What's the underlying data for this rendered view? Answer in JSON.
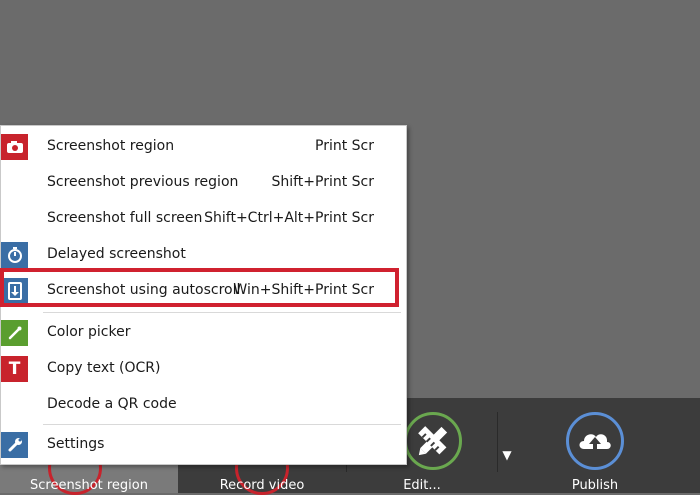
{
  "toolbar": {
    "buttons": [
      {
        "label": "Screenshot region"
      },
      {
        "label": "Record video"
      },
      {
        "label": "Edit..."
      },
      {
        "label": "Publish"
      }
    ],
    "dropdown_glyph": "▼"
  },
  "menu": {
    "items": [
      {
        "label": "Screenshot region",
        "shortcut": "Print Scr",
        "icon": "camera-icon"
      },
      {
        "label": "Screenshot previous region",
        "shortcut": "Shift+Print Scr"
      },
      {
        "label": "Screenshot full screen",
        "shortcut": "Shift+Ctrl+Alt+Print Scr"
      },
      {
        "label": "Delayed screenshot",
        "icon": "stopwatch-icon"
      },
      {
        "label": "Screenshot using autoscroll",
        "shortcut": "Win+Shift+Print Scr",
        "icon": "autoscroll-icon",
        "highlighted": true
      },
      {
        "label": "Color picker",
        "icon": "eyedropper-icon"
      },
      {
        "label": "Copy text (OCR)",
        "icon": "text-t-icon",
        "icon_text": "T"
      },
      {
        "label": "Decode a QR code"
      },
      {
        "label": "Settings",
        "icon": "wrench-icon"
      }
    ]
  },
  "colors": {
    "background": "#6b6b6b",
    "toolbar": "#3c3c3c",
    "highlight_border": "#d0212f",
    "camera_icon_bg": "#c8232c",
    "blue_icon_bg": "#3a6ea5",
    "green_icon_bg": "#5a9e2f",
    "edit_ring": "#6aa84f",
    "publish_ring": "#5b8fd6"
  }
}
